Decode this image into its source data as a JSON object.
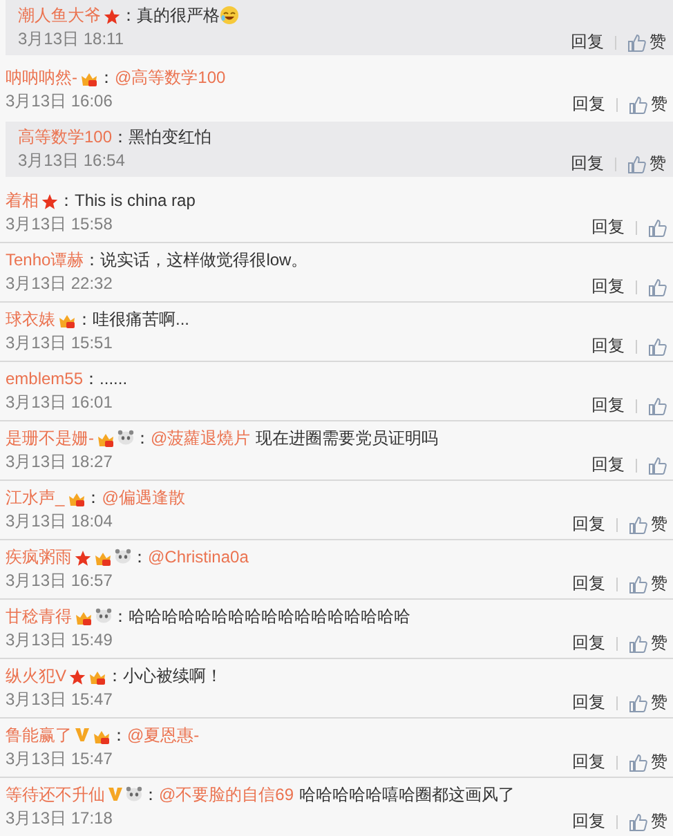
{
  "comments": [
    {
      "kind": "reply",
      "user": "潮人鱼大爷",
      "badges": [
        {
          "kind": "star"
        }
      ],
      "colon": "：",
      "text": "真的很严格",
      "emoji": true,
      "time": "3月13日 18:11",
      "reply": "回复",
      "like": "赞"
    },
    {
      "kind": "comment",
      "user": "呐呐呐然-",
      "badges": [
        {
          "kind": "vip"
        }
      ],
      "colon": "：",
      "mention": "@高等数学100",
      "time": "3月13日 16:06",
      "reply": "回复",
      "like": "赞"
    },
    {
      "kind": "reply",
      "user": "高等数学100",
      "colon": "：",
      "text": "黑怕变红怕",
      "time": "3月13日 16:54",
      "reply": "回复",
      "like": "赞"
    },
    {
      "kind": "comment",
      "user": "着相",
      "badges": [
        {
          "kind": "star"
        }
      ],
      "colon": "：",
      "text": "This is china rap",
      "time": "3月13日 15:58",
      "reply": "回复"
    },
    {
      "kind": "comment",
      "user": "Tenho谭赫",
      "colon": "：",
      "text": "说实话，这样做觉得很low。",
      "time": "3月13日 22:32",
      "reply": "回复"
    },
    {
      "kind": "comment",
      "user": "球衣婊",
      "badges": [
        {
          "kind": "vip"
        }
      ],
      "colon": "：",
      "text": "哇很痛苦啊...",
      "time": "3月13日 15:51",
      "reply": "回复"
    },
    {
      "kind": "comment",
      "user": "emblem55",
      "colon": "：",
      "text": "......",
      "time": "3月13日 16:01",
      "reply": "回复"
    },
    {
      "kind": "comment",
      "user": "是珊不是姗-",
      "badges": [
        {
          "kind": "vip"
        },
        {
          "kind": "panda"
        }
      ],
      "colon": "：",
      "mention": "@菠蘿退燒片",
      "text": "现在进圈需要党员证明吗",
      "time": "3月13日 18:27",
      "reply": "回复"
    },
    {
      "kind": "comment",
      "user": "江水声_",
      "badges": [
        {
          "kind": "vip"
        }
      ],
      "colon": "：",
      "mention": "@偏遇逢散",
      "time": "3月13日 18:04",
      "reply": "回复",
      "like": "赞"
    },
    {
      "kind": "comment",
      "user": "疾疯粥雨",
      "badges": [
        {
          "kind": "star"
        },
        {
          "kind": "vip"
        },
        {
          "kind": "panda"
        }
      ],
      "colon": "：",
      "mention": "@Christina0a",
      "time": "3月13日 16:57",
      "reply": "回复",
      "like": "赞"
    },
    {
      "kind": "comment",
      "user": "甘稔青得",
      "badges": [
        {
          "kind": "vip"
        },
        {
          "kind": "panda"
        }
      ],
      "colon": "：",
      "text": "哈哈哈哈哈哈哈哈哈哈哈哈哈哈哈哈哈",
      "time": "3月13日 15:49",
      "reply": "回复",
      "like": "赞"
    },
    {
      "kind": "comment",
      "user": "纵火犯V",
      "badges": [
        {
          "kind": "star"
        },
        {
          "kind": "vip"
        }
      ],
      "colon": "：",
      "text": "小心被续啊！",
      "time": "3月13日 15:47",
      "reply": "回复",
      "like": "赞"
    },
    {
      "kind": "comment",
      "user": "鲁能赢了",
      "badges": [
        {
          "kind": "v"
        },
        {
          "kind": "vip"
        }
      ],
      "colon": "：",
      "mention": "@夏恩惠-",
      "time": "3月13日 15:47",
      "reply": "回复",
      "like": "赞"
    },
    {
      "kind": "comment",
      "user": "等待还不升仙",
      "badges": [
        {
          "kind": "v"
        },
        {
          "kind": "panda"
        }
      ],
      "colon": "：",
      "mention": "@不要脸的自信69",
      "text": "哈哈哈哈哈嘻哈圈都这画风了",
      "time": "3月13日 17:18",
      "reply": "回复",
      "like": "赞"
    }
  ]
}
